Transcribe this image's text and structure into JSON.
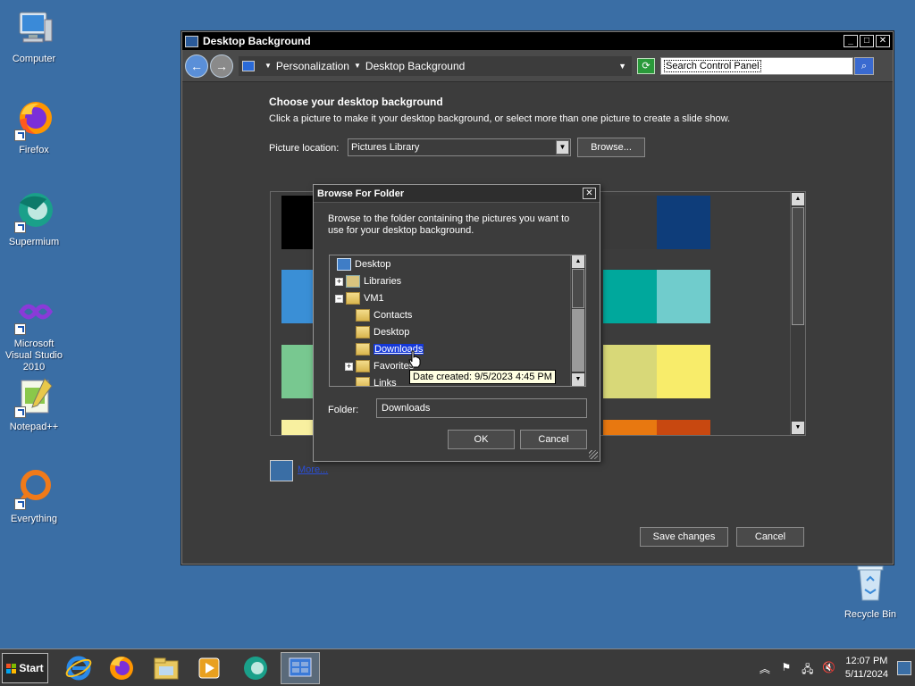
{
  "desktop": {
    "icons": [
      {
        "label": "Computer",
        "icon": "computer-icon"
      },
      {
        "label": "Firefox",
        "icon": "firefox-icon"
      },
      {
        "label": "Supermium",
        "icon": "supermium-icon"
      },
      {
        "label": "Microsoft Visual Studio 2010",
        "icon": "visual-studio-icon"
      },
      {
        "label": "Notepad++",
        "icon": "notepadpp-icon"
      },
      {
        "label": "Everything",
        "icon": "everything-icon"
      },
      {
        "label": "Recycle Bin",
        "icon": "recycle-bin-icon"
      }
    ]
  },
  "window": {
    "title": "Desktop Background",
    "breadcrumb": [
      "Personalization",
      "Desktop Background"
    ],
    "search_placeholder": "Search Control Panel",
    "heading": "Choose your desktop background",
    "subtext": "Click a picture to make it your desktop background, or select more than one picture to create a slide show.",
    "location_label": "Picture location:",
    "location_value": "Pictures Library",
    "browse_label": "Browse...",
    "more_label": "More...",
    "save_label": "Save changes",
    "cancel_label": "Cancel",
    "swatch_colors": {
      "row1": [
        "#000000",
        "#3c3c3c",
        "#3c3c3c",
        "#3c3c3c",
        "#3a3a3a",
        "#0e3d7a"
      ],
      "row2": [
        "#3a8fd6",
        "#3c3c3c",
        "#3c3c3c",
        "#3c3c3c",
        "#00a89c",
        "#70cccc"
      ],
      "row3": [
        "#78c890",
        "#3c3c3c",
        "#3c3c3c",
        "#3c3c3c",
        "#d8d878",
        "#f8ec6a"
      ],
      "row4": [
        "#f8f0a0",
        "#3c3c3c",
        "#3c3c3c",
        "#3c3c3c",
        "#e87810",
        "#c84810"
      ]
    }
  },
  "dialog": {
    "title": "Browse For Folder",
    "description": "Browse to the folder containing the pictures you want to use for your desktop background.",
    "tree": [
      {
        "label": "Desktop",
        "icon": "desktop-icon",
        "expander": ""
      },
      {
        "label": "Libraries",
        "icon": "libraries-icon",
        "expander": "+"
      },
      {
        "label": "VM1",
        "icon": "user-folder-icon",
        "expander": "−"
      },
      {
        "label": "Contacts",
        "icon": "folder-icon",
        "expander": ""
      },
      {
        "label": "Desktop",
        "icon": "folder-icon",
        "expander": ""
      },
      {
        "label": "Downloads",
        "icon": "folder-icon",
        "expander": "",
        "selected": true
      },
      {
        "label": "Favorites",
        "icon": "folder-icon",
        "expander": "+"
      },
      {
        "label": "Links",
        "icon": "folder-icon",
        "expander": ""
      }
    ],
    "tooltip": "Date created: 9/5/2023 4:45 PM",
    "folder_label": "Folder:",
    "folder_value": "Downloads",
    "ok_label": "OK",
    "cancel_label": "Cancel"
  },
  "taskbar": {
    "start_label": "Start",
    "apps": [
      "internet-explorer-icon",
      "firefox-icon",
      "explorer-icon",
      "media-player-icon",
      "supermium-icon",
      "control-panel-icon"
    ],
    "clock_time": "12:07 PM",
    "clock_date": "5/11/2024"
  }
}
